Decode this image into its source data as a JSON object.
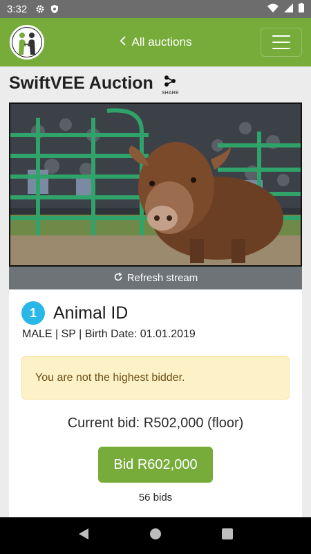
{
  "status_bar": {
    "time": "3:32",
    "icons": [
      "settings-icon",
      "shield-icon",
      "wifi-icon",
      "signal-icon",
      "battery-icon"
    ]
  },
  "app_bar": {
    "back_label": "All auctions",
    "icons": [
      "logo",
      "chevron-left-icon",
      "menu-icon"
    ],
    "color": "#77ac3b"
  },
  "page": {
    "title": "SwiftVEE Auction",
    "share_label": "SHARE"
  },
  "stream": {
    "refresh_label": "Refresh stream"
  },
  "lot": {
    "number": "1",
    "animal_id": "Animal ID",
    "meta": "MALE | SP | Birth Date: 01.01.2019",
    "alert": "You are not the highest bidder.",
    "current_bid": "Current bid: R502,000 (floor)",
    "bid_button": "Bid R602,000",
    "bids_count": "56 bids"
  },
  "colors": {
    "accent": "#77ac3b",
    "lot_badge": "#29b6e8",
    "alert_bg": "#fdf1c8",
    "alert_text": "#6a4f14",
    "refresh_bar": "#6e7378"
  },
  "nav_bar": {
    "icons": [
      "back-icon",
      "home-icon",
      "recents-icon"
    ]
  }
}
